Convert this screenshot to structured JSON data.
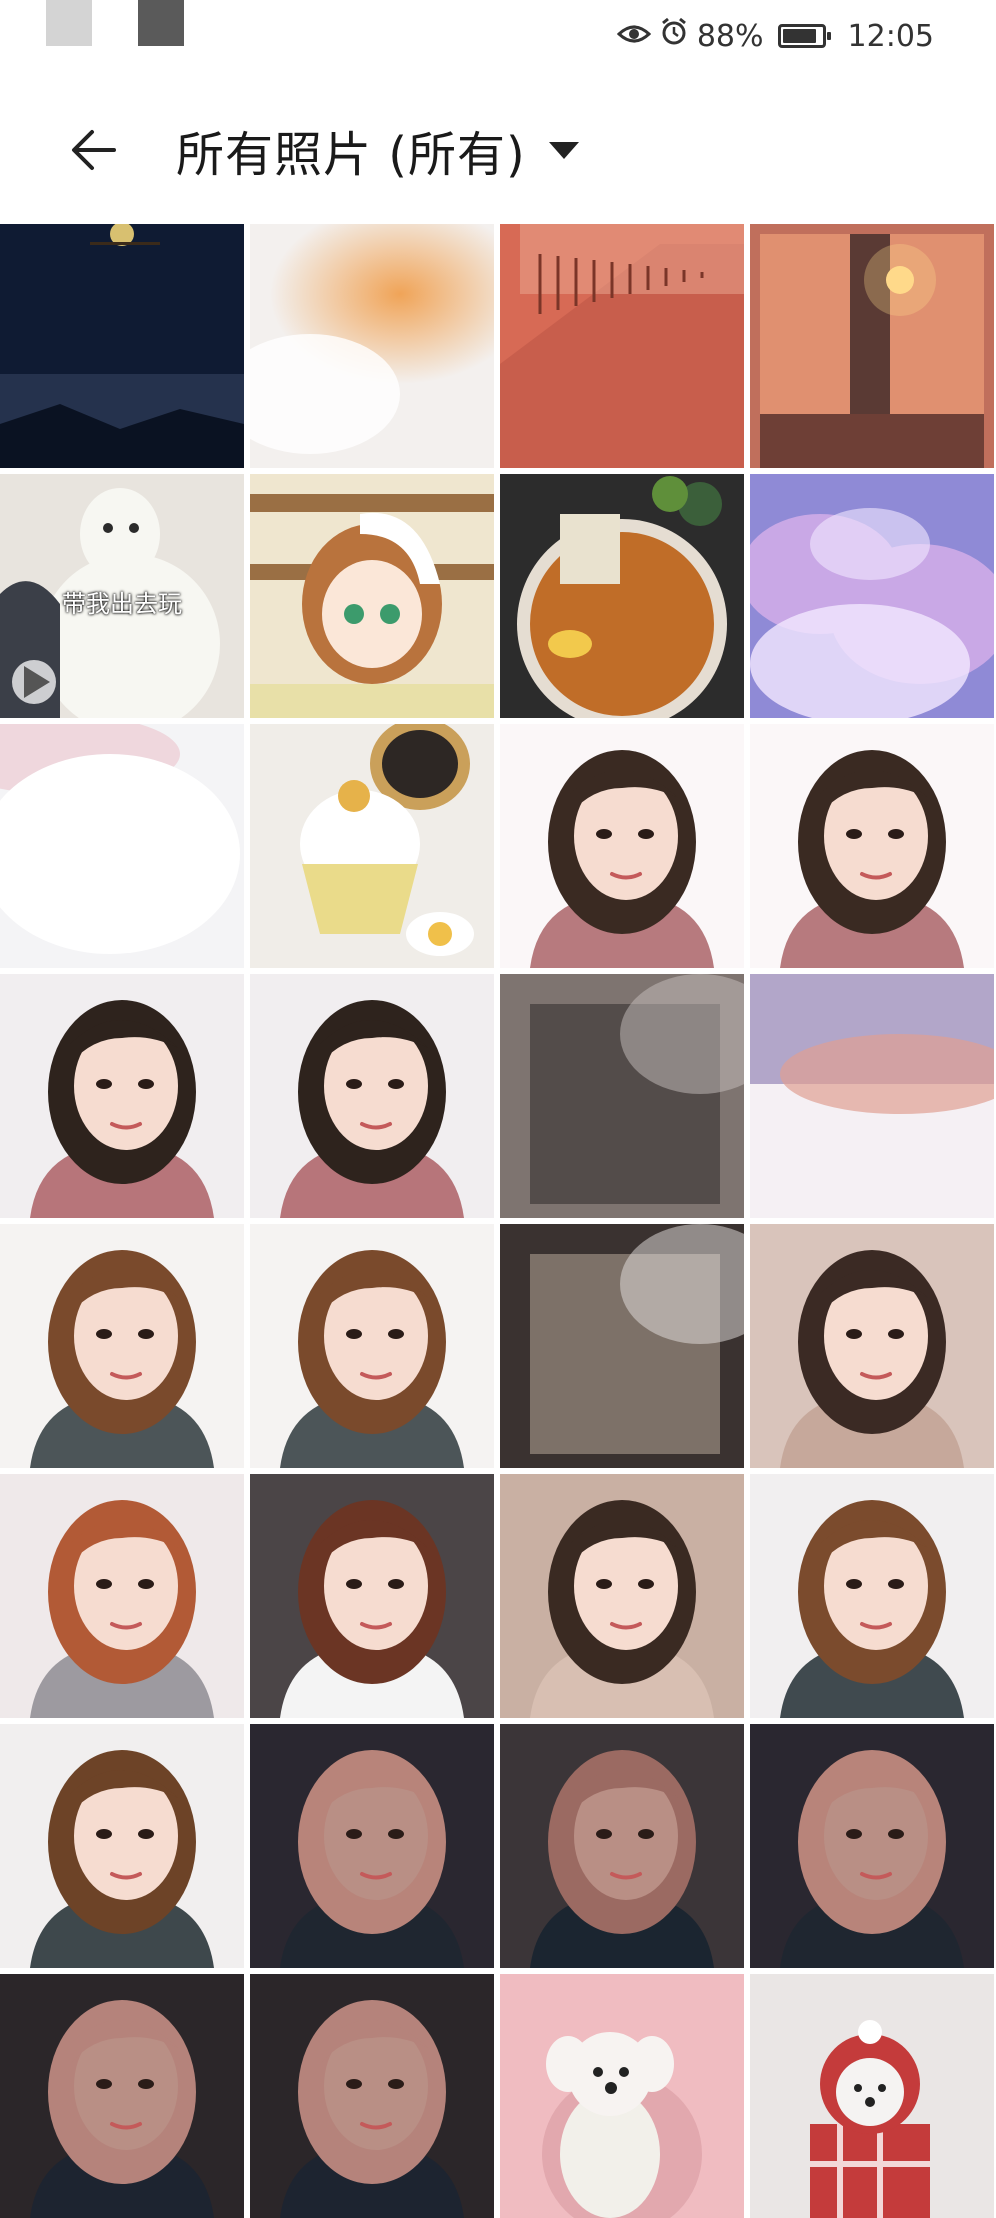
{
  "status_bar": {
    "battery_percent": "88%",
    "battery_level": 0.88,
    "time": "12:05",
    "icons": [
      "eye-icon",
      "alarm-icon",
      "battery-icon"
    ]
  },
  "header": {
    "back_icon": "arrow-left-icon",
    "title": "所有照片 (所有)",
    "dropdown_icon": "caret-down-icon"
  },
  "photos": [
    {
      "kind": "night-moon",
      "colors": [
        "#0f1b33",
        "#25324d",
        "#d8c070"
      ]
    },
    {
      "kind": "blur-orange",
      "colors": [
        "#f3f0ee",
        "#f0a050",
        "#ffffff"
      ]
    },
    {
      "kind": "staircase",
      "colors": [
        "#d76a55",
        "#c85e4c",
        "#e9a48e"
      ]
    },
    {
      "kind": "window-sunset",
      "colors": [
        "#c06f5c",
        "#e09070",
        "#ffd98a"
      ]
    },
    {
      "kind": "alpaca-video",
      "colors": [
        "#e8e4de",
        "#f7f7f2",
        "#2b2b2b"
      ],
      "caption": "带我出去玩",
      "video": true
    },
    {
      "kind": "anime",
      "colors": [
        "#efe6cf",
        "#b9733d",
        "#ffffff"
      ]
    },
    {
      "kind": "noodle",
      "colors": [
        "#2c2c2c",
        "#c06d28",
        "#3b5f3a"
      ]
    },
    {
      "kind": "clouds",
      "colors": [
        "#8f8ad6",
        "#c9a8e6",
        "#f2e7ff"
      ]
    },
    {
      "kind": "blur-white",
      "colors": [
        "#f4f4f6",
        "#e6a0b0",
        "#ffffff"
      ]
    },
    {
      "kind": "cupcake",
      "colors": [
        "#f0ede8",
        "#eadb8a",
        "#ffffff"
      ]
    },
    {
      "kind": "portrait-pink",
      "colors": [
        "#fbf7f8",
        "#b77a7e",
        "#3a2a22"
      ]
    },
    {
      "kind": "portrait-pink",
      "colors": [
        "#fbf7f8",
        "#b77a7e",
        "#3a2a22"
      ]
    },
    {
      "kind": "portrait-pink",
      "colors": [
        "#f1eef0",
        "#b7757a",
        "#2e231d"
      ]
    },
    {
      "kind": "portrait-pink",
      "colors": [
        "#f1eef0",
        "#b7757a",
        "#2e231d"
      ]
    },
    {
      "kind": "blur-dark",
      "colors": [
        "#7e7470",
        "#4b4543",
        "#c8c0bd"
      ]
    },
    {
      "kind": "blur-purple",
      "colors": [
        "#b2a6c9",
        "#e0a093",
        "#f5f0f4"
      ]
    },
    {
      "kind": "portrait-gray",
      "colors": [
        "#f5f3f2",
        "#4c5558",
        "#7a4a2c"
      ]
    },
    {
      "kind": "portrait-gray",
      "colors": [
        "#f5f3f2",
        "#4c5558",
        "#7a4a2c"
      ]
    },
    {
      "kind": "blur-dark",
      "colors": [
        "#3a3230",
        "#8a7c72",
        "#e8e4e2"
      ]
    },
    {
      "kind": "portrait-beige",
      "colors": [
        "#d9c4bb",
        "#c6a89b",
        "#3b2a24"
      ]
    },
    {
      "kind": "portrait-sweater",
      "colors": [
        "#efe9ea",
        "#9d9aa0",
        "#b25a36"
      ]
    },
    {
      "kind": "portrait-white",
      "colors": [
        "#4b4547",
        "#f4f4f4",
        "#6b3524"
      ]
    },
    {
      "kind": "portrait-beige",
      "colors": [
        "#c9b0a3",
        "#d8bfb2",
        "#3a2a22"
      ]
    },
    {
      "kind": "portrait-gray",
      "colors": [
        "#f1eff0",
        "#404a4f",
        "#7b4b2d"
      ]
    },
    {
      "kind": "portrait-gray",
      "colors": [
        "#f1efef",
        "#3e484c",
        "#6d4327"
      ]
    },
    {
      "kind": "portrait-dark",
      "colors": [
        "#2a2730",
        "#1f2630",
        "#b8847a"
      ]
    },
    {
      "kind": "portrait-dark",
      "colors": [
        "#3b3538",
        "#1b2530",
        "#9b6a62"
      ]
    },
    {
      "kind": "portrait-dark",
      "colors": [
        "#2a2730",
        "#1f2630",
        "#b8847a"
      ]
    },
    {
      "kind": "portrait-dark",
      "colors": [
        "#2b2629",
        "#1d2430",
        "#b5837b"
      ]
    },
    {
      "kind": "portrait-dark",
      "colors": [
        "#2b2629",
        "#1d2430",
        "#b5837b"
      ]
    },
    {
      "kind": "dog-pink",
      "colors": [
        "#f0bcc1",
        "#f7f3f1",
        "#e2a8ae"
      ]
    },
    {
      "kind": "dog-plaid",
      "colors": [
        "#eae6e5",
        "#c43b3b",
        "#f5f3f2"
      ]
    }
  ]
}
